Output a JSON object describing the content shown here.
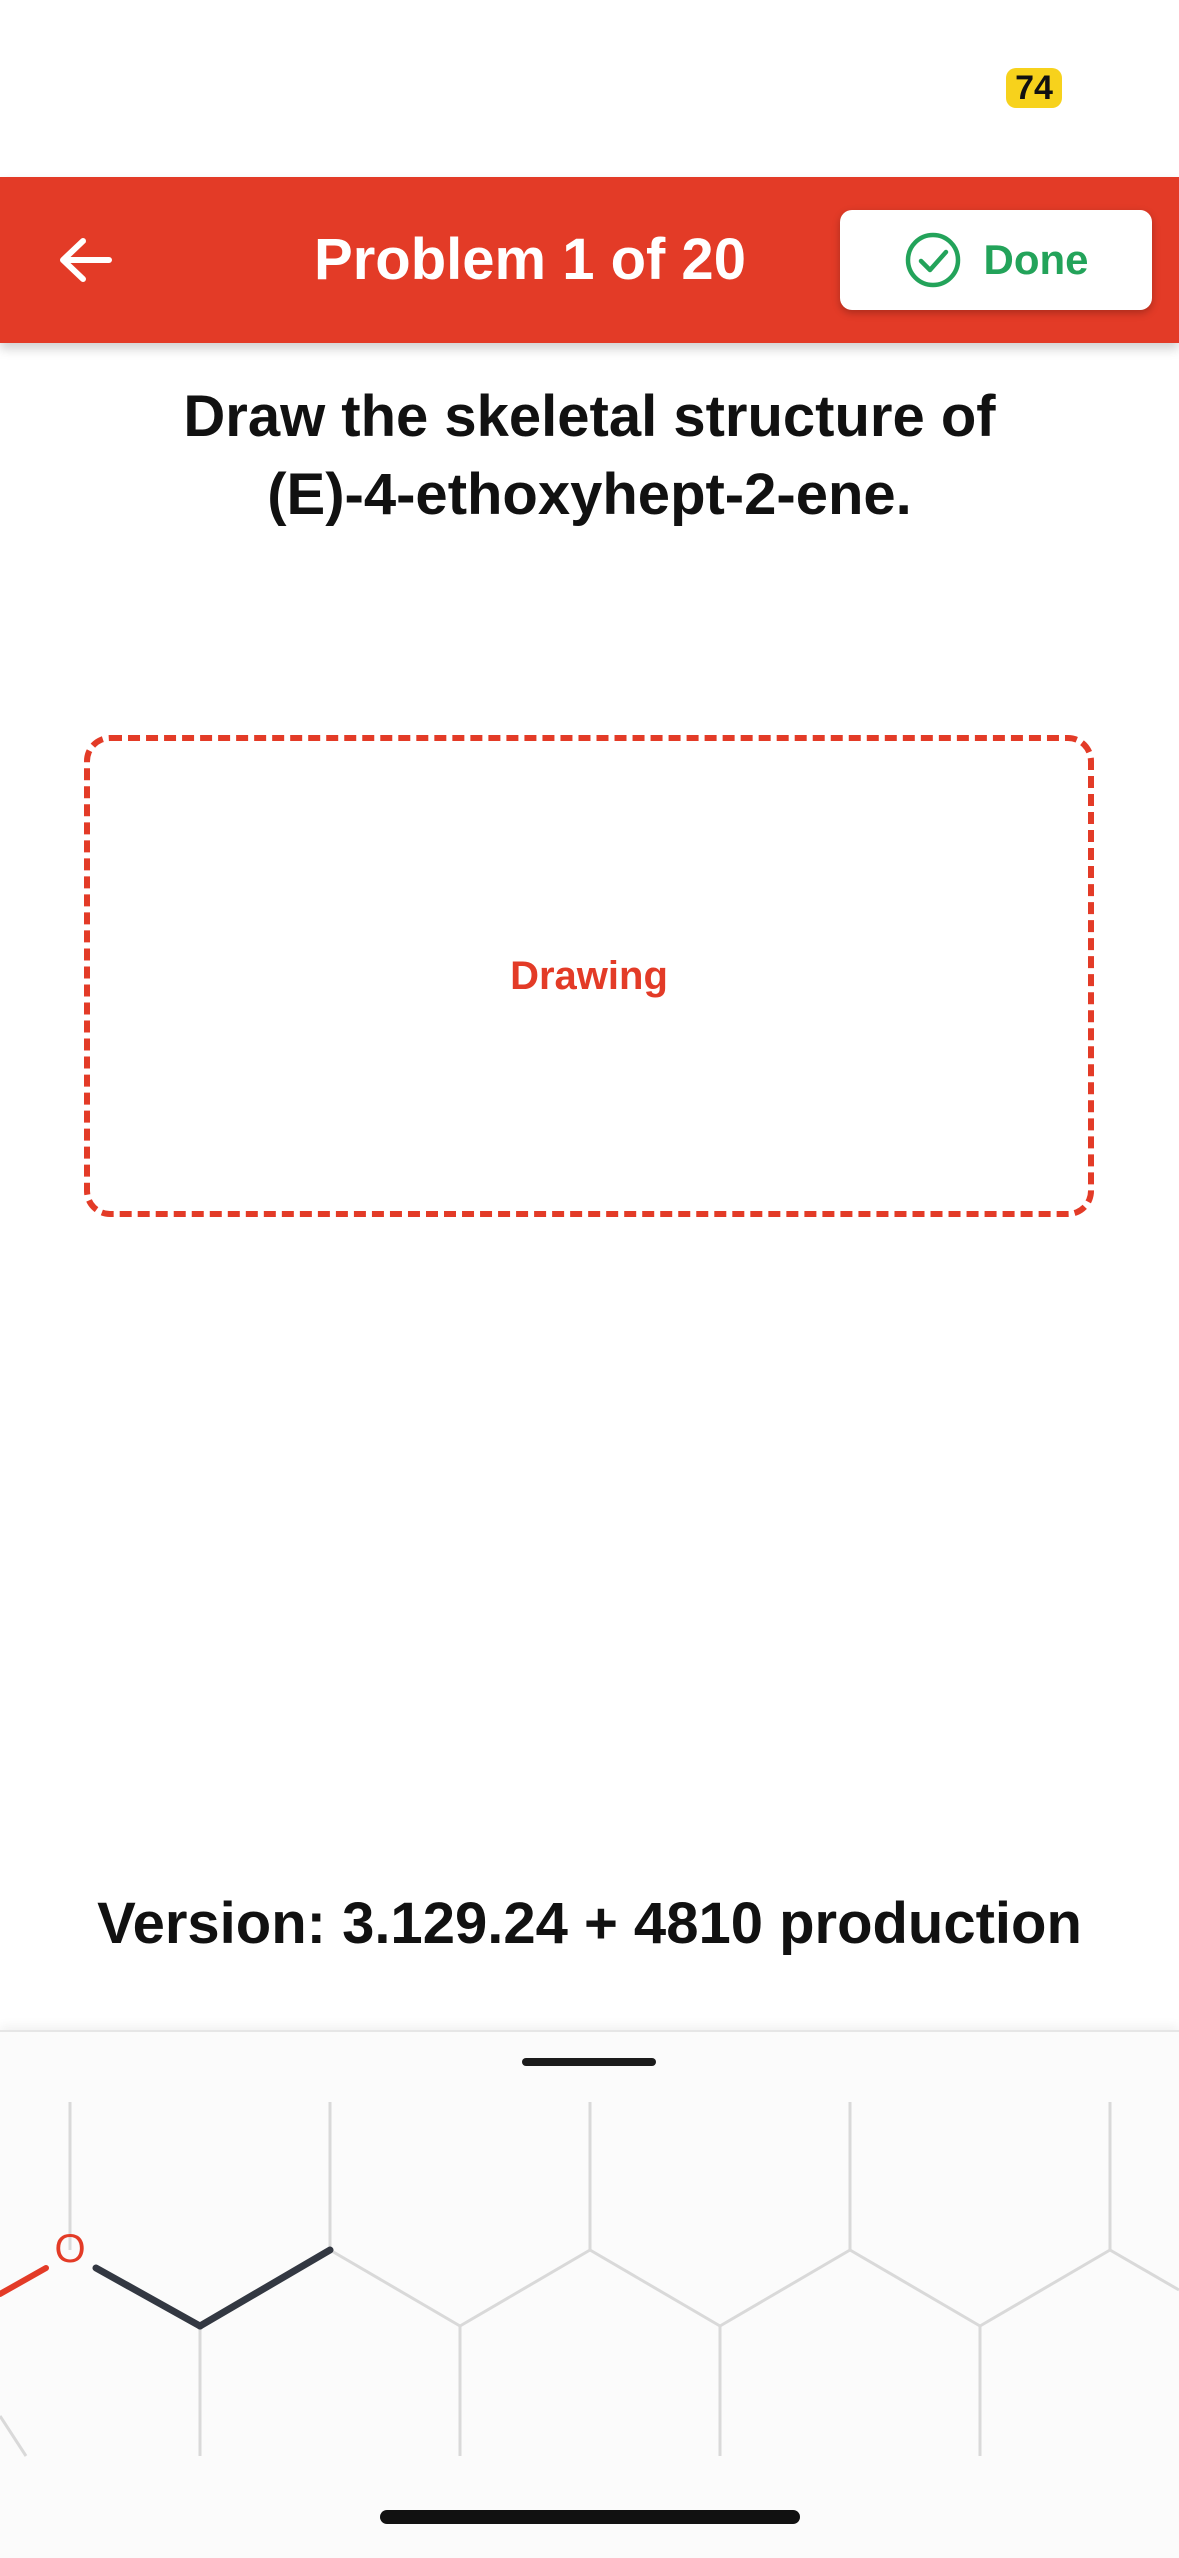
{
  "status_bar": {
    "badge": "74"
  },
  "header": {
    "title": "Problem 1 of 20",
    "back_icon": "arrow-left-icon",
    "done_label": "Done",
    "done_icon": "check-circle-icon",
    "background_color": "#e33b27",
    "done_color": "#23a35a"
  },
  "question": {
    "line1": "Draw the skeletal structure of",
    "line2": "(E)-4-ethoxyhept-2-ene."
  },
  "drawing_area": {
    "label": "Drawing"
  },
  "version_text": "Version: 3.129.24 + 4810 production",
  "molecule_sheet": {
    "atom_label": "O",
    "grid_color": "#d9d9d9",
    "bond_color": "#333842",
    "oxygen_color": "#e33b27"
  }
}
